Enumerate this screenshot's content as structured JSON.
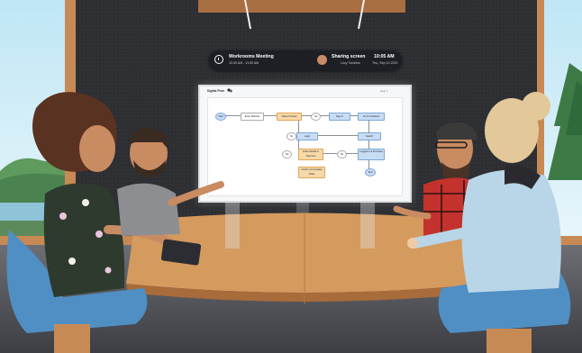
{
  "meeting_bar": {
    "title": "Workrooms Meeting",
    "time_range": "10:00 AM - 11:00 AM",
    "status": "Sharing screen",
    "presenter": "Lucy Tomkins",
    "clock_time": "10:05 AM",
    "date": "Thu, Sep 10 2021"
  },
  "shared_screen": {
    "app_name": "Digital Flow",
    "controls": "●●● ▭"
  },
  "colors": {
    "wall": "#2b2c30",
    "table": "#d59a5e",
    "chair": "#4f8fc4",
    "flow_blue": "#c8dcf3",
    "flow_orange": "#f7d9a8"
  },
  "flowchart": {
    "nodes": [
      {
        "id": "n1",
        "label": "Start"
      },
      {
        "id": "n2",
        "label": "Enter Website"
      },
      {
        "id": "n3",
        "label": "Select Product"
      },
      {
        "id": "n4",
        "label": "Yes"
      },
      {
        "id": "n5",
        "label": "Sign In"
      },
      {
        "id": "n6",
        "label": "Go To Checkout"
      },
      {
        "id": "n7",
        "label": "No"
      },
      {
        "id": "n8",
        "label": "Login"
      },
      {
        "id": "n9",
        "label": "Search"
      },
      {
        "id": "n10",
        "label": "Yes"
      },
      {
        "id": "n11",
        "label": "Enter Details & Payment"
      },
      {
        "id": "n12",
        "label": "No"
      },
      {
        "id": "n13",
        "label": "Logged In & Purchase"
      },
      {
        "id": "n14",
        "label": "Confirm & Complete Order"
      },
      {
        "id": "n15",
        "label": "End"
      }
    ]
  }
}
